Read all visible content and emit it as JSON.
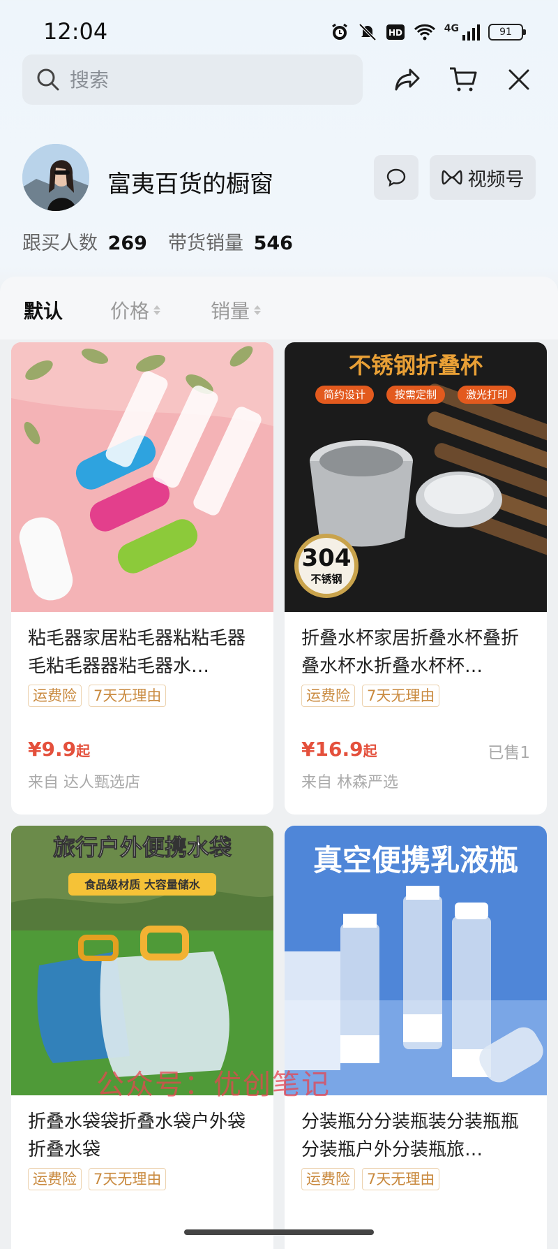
{
  "status_bar": {
    "time": "12:04",
    "network": "4G",
    "battery": "91",
    "icons": [
      "alarm-icon",
      "mute-icon",
      "hd-icon",
      "wifi-icon",
      "signal-icon",
      "battery-icon"
    ]
  },
  "top_bar": {
    "search_placeholder": "搜索",
    "actions": [
      "share-icon",
      "cart-icon",
      "close-icon"
    ]
  },
  "profile": {
    "shop_name": "富夷百货的橱窗",
    "channel_label": "视频号",
    "stats": [
      {
        "label": "跟买人数",
        "value": "269"
      },
      {
        "label": "带货销量",
        "value": "546"
      }
    ]
  },
  "sort_tabs": [
    {
      "label": "默认",
      "active": true
    },
    {
      "label": "价格",
      "active": false
    },
    {
      "label": "销量",
      "active": false
    }
  ],
  "products": [
    {
      "title": "粘毛器家居粘毛器粘粘毛器毛粘毛器器粘毛器水…",
      "tags": [
        "运费险",
        "7天无理由"
      ],
      "price": "¥9.9",
      "price_suffix": "起",
      "sold": "",
      "source": "来自 达人甄选店"
    },
    {
      "title": "折叠水杯家居折叠水杯叠折叠水杯水折叠水杯杯…",
      "image_text": {
        "headline": "不锈钢折叠杯",
        "chips": [
          "简约设计",
          "按需定制",
          "激光打印"
        ],
        "badge_top": "304",
        "badge_bottom": "不锈钢"
      },
      "tags": [
        "运费险",
        "7天无理由"
      ],
      "price": "¥16.9",
      "price_suffix": "起",
      "sold": "已售1",
      "source": "来自 林森严选"
    },
    {
      "title": "折叠水袋袋折叠水袋户外袋折叠水袋",
      "image_text": {
        "headline": "旅行户外便携水袋",
        "subline": "食品级材质 大容量储水"
      },
      "tags": [
        "运费险",
        "7天无理由"
      ]
    },
    {
      "title": "分装瓶分分装瓶装分装瓶瓶分装瓶户外分装瓶旅…",
      "image_text": {
        "headline": "真空便携乳液瓶"
      },
      "tags": [
        "运费险",
        "7天无理由"
      ]
    }
  ],
  "watermark": "公众号：优创笔记"
}
